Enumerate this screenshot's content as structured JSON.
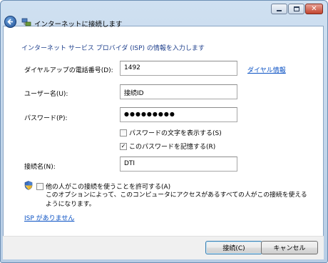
{
  "window": {
    "title": "インターネットに接続します",
    "close_glyph": "✕"
  },
  "header": "インターネット サービス プロバイダ (ISP) の情報を入力します",
  "form": {
    "phone_label": "ダイヤルアップの電話番号(D):",
    "phone_value": "1492",
    "dialing_rules_link": "ダイヤル情報",
    "username_label": "ユーザー名(U):",
    "username_value": "接続ID",
    "password_label": "パスワード(P):",
    "password_value": "●●●●●●●●●",
    "show_chars_label": "パスワードの文字を表示する(S)",
    "show_chars_checked": false,
    "remember_label": "このパスワードを記憶する(R)",
    "remember_checked": true,
    "remember_check_glyph": "✓",
    "connection_name_label": "接続名(N):",
    "connection_name_value": "DTI",
    "allow_others_label": "他の人がこの接続を使うことを許可する(A)",
    "allow_others_checked": false,
    "allow_others_desc": "このオプションによって、このコンピュータにアクセスがあるすべての人がこの接続を使えるようになります。",
    "no_isp_link": "ISP がありません"
  },
  "footer": {
    "connect_button": "接続(C)",
    "cancel_button": "キャンセル"
  },
  "colors": {
    "header_text": "#1e3f8c",
    "link": "#0b52c4"
  },
  "icons": {
    "back": "back-arrow-icon",
    "network": "network-connection-icon",
    "shield": "uac-shield-icon"
  }
}
